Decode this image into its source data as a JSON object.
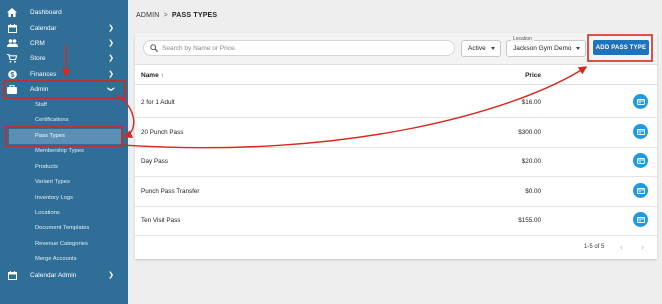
{
  "sidebar": {
    "items": [
      {
        "label": "Dashboard",
        "icon": "home-icon",
        "has_chevron": false
      },
      {
        "label": "Calendar",
        "icon": "calendar-icon",
        "has_chevron": true
      },
      {
        "label": "CRM",
        "icon": "people-icon",
        "has_chevron": true
      },
      {
        "label": "Store",
        "icon": "cart-icon",
        "has_chevron": true
      },
      {
        "label": "Finances",
        "icon": "dollar-icon",
        "has_chevron": true
      },
      {
        "label": "Admin",
        "icon": "briefcase-icon",
        "has_chevron": true,
        "expanded": true
      }
    ],
    "admin_sub_items": [
      "Staff",
      "Certifications",
      "Pass Types",
      "Membership Types",
      "Products",
      "Variant Types",
      "Inventory Logs",
      "Locations",
      "Document Templates",
      "Revenue Categories",
      "Merge Accounts"
    ],
    "active_sub_item": "Pass Types",
    "calendar_admin": {
      "label": "Calendar Admin",
      "icon": "calendar-icon",
      "has_chevron": true
    }
  },
  "breadcrumb": {
    "parent": "ADMIN",
    "separator": ">",
    "current": "PASS TYPES"
  },
  "toolbar": {
    "search_placeholder": "Search by Name or Price.",
    "status_value": "Active",
    "location_label": "Location",
    "location_value": "Jackson Gym Demo",
    "add_button_label": "ADD PASS TYPE"
  },
  "table": {
    "columns": {
      "name": "Name",
      "sort_indicator": "↑",
      "price": "Price"
    },
    "rows": [
      {
        "name": "2 for 1 Adult",
        "price": "$16.00"
      },
      {
        "name": "20 Punch Pass",
        "price": "$300.00"
      },
      {
        "name": "Day Pass",
        "price": "$20.00"
      },
      {
        "name": "Punch Pass Transfer",
        "price": "$0.00"
      },
      {
        "name": "Ten Visit Pass",
        "price": "$155.00"
      }
    ],
    "pagination": {
      "range": "1-5 of 5",
      "prev": "‹",
      "next": "›"
    }
  },
  "colors": {
    "sidebar_bg": "#2f6e97",
    "accent_blue": "#1e73be",
    "edit_button": "#1e9be0",
    "annotation_red": "#d9271c"
  }
}
